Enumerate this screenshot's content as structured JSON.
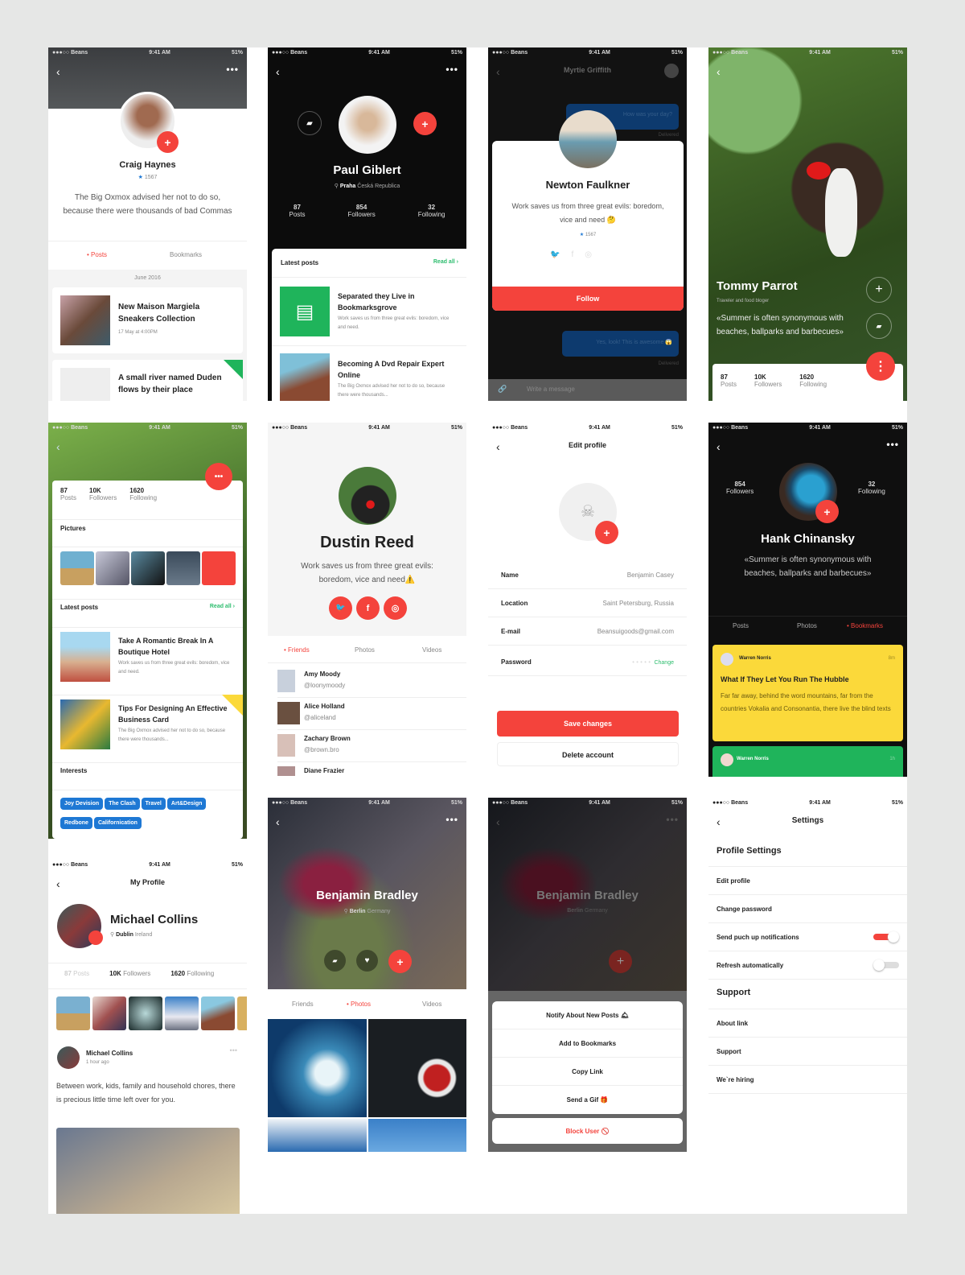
{
  "status": {
    "carrier": "●●●○○ Beans",
    "time": "9:41 AM",
    "battery": "51%"
  },
  "colors": {
    "accent": "#f4433c",
    "link": "#2dbd6e",
    "tag": "#1e78d4",
    "yellow": "#fbd93a",
    "green": "#1fb45b"
  },
  "s1": {
    "name": "Craig Haynes",
    "rating": "1567",
    "bio": "The Big Oxmox advised her not to do so, because there were thousands of bad Commas",
    "tabs": [
      "Posts",
      "Bookmarks"
    ],
    "date": "June 2016",
    "posts": [
      {
        "title": "New Maison Margiela Sneakers Collection",
        "meta": "17 May at 4:00PM"
      },
      {
        "title": "A small river named Duden flows by their place"
      }
    ]
  },
  "s2": {
    "name": "Paul Giblert",
    "city": "Praha",
    "country": "Česká Republica",
    "stats": [
      {
        "v": "87",
        "l": "Posts"
      },
      {
        "v": "854",
        "l": "Followers"
      },
      {
        "v": "32",
        "l": "Following"
      }
    ],
    "latest": "Latest posts",
    "read_all": "Read all ›",
    "posts": [
      {
        "title": "Separated they Live in Bookmarksgrove",
        "text": "Work saves us from three great evils: boredom, vice and need."
      },
      {
        "title": "Becoming A Dvd Repair Expert Online",
        "text": "The Big Oxmox advised her not to do so, because there were thousands..."
      }
    ]
  },
  "s3": {
    "title": "Myrtie Griffith",
    "bubble1": "How was your day?",
    "delivered": "Delivered",
    "bubble2": "Yes, look! This is awesome 😱",
    "name": "Newton Faulkner",
    "text": "Work saves us from three great evils: boredom, vice and need 🤔",
    "rating": "1567",
    "follow": "Follow",
    "input_placeholder": "Write a message"
  },
  "s4": {
    "name": "Tommy Parrot",
    "subtitle": "Traveler and food bloger",
    "quote": "«Summer is often synonymous with beaches, ballparks and barbecues»",
    "stats": [
      {
        "v": "87",
        "l": "Posts"
      },
      {
        "v": "10K",
        "l": "Followers"
      },
      {
        "v": "1620",
        "l": "Following"
      }
    ]
  },
  "s5": {
    "stats": [
      {
        "v": "87",
        "l": "Posts"
      },
      {
        "v": "10K",
        "l": "Followers"
      },
      {
        "v": "1620",
        "l": "Following"
      }
    ],
    "pictures": "Pictures",
    "latest": "Latest posts",
    "read_all": "Read all ›",
    "posts": [
      {
        "title": "Take A Romantic Break In A Boutique Hotel",
        "text": "Work saves us from three great evils: boredom, vice and need."
      },
      {
        "title": "Tips For Designing An Effective Business Card",
        "text": "The Big Oxmox advised her not to do so, because there were thousands..."
      }
    ],
    "interests": "Interests",
    "tags": [
      "Joy Devision",
      "The Clash",
      "Travel",
      "Art&Design",
      "Redbone",
      "Californication"
    ]
  },
  "s6": {
    "name": "Dustin Reed",
    "text": "Work saves us from three great evils: boredom, vice and need⚠️",
    "tabs": [
      "Friends",
      "Photos",
      "Videos"
    ],
    "friends": [
      {
        "name": "Amy Moody",
        "handle": "@loonymoody"
      },
      {
        "name": "Alice Holland",
        "handle": "@aliceland"
      },
      {
        "name": "Zachary Brown",
        "handle": "@brown.bro"
      },
      {
        "name": "Diane Frazier"
      }
    ]
  },
  "s7": {
    "title": "Edit profile",
    "fields": [
      {
        "label": "Name",
        "value": "Benjamin Casey"
      },
      {
        "label": "Location",
        "value": "Saint Petersburg, Russia"
      },
      {
        "label": "E-mail",
        "value": "Beansuigoods@gmail.com"
      },
      {
        "label": "Password",
        "value": "• • • • •",
        "action": "Change"
      }
    ],
    "save": "Save changes",
    "delete": "Delete account"
  },
  "s8": {
    "name": "Hank Chinansky",
    "quote": "«Summer is often synonymous with beaches, ballparks and barbecues»",
    "stats": [
      {
        "v": "854",
        "l": "Followers"
      },
      {
        "v": "32",
        "l": "Following"
      }
    ],
    "tabs": [
      "Posts",
      "Photos",
      "Bookmarks"
    ],
    "cards": [
      {
        "author": "Warren Norris",
        "time": "8m",
        "title": "What If They Let You Run The Hubble",
        "text": "Far far away, behind the word mountains, far from the countries Vokalia and Consonantia, there live the blind texts"
      },
      {
        "author": "Warren Norris",
        "time": "1h"
      }
    ]
  },
  "s9": {
    "title": "My Profile",
    "name": "Michael Collins",
    "city": "Dublin",
    "country": "Ireland",
    "stats": [
      {
        "v": "87",
        "l": "Posts"
      },
      {
        "v": "10K",
        "l": "Followers"
      },
      {
        "v": "1620",
        "l": "Following"
      }
    ],
    "post_author": "Michael Collins",
    "post_time": "1 hour ago",
    "post_text": "Between work, kids, family and household chores, there is precious little time left over for you."
  },
  "s10": {
    "name": "Benjamin Bradley",
    "city": "Berlin",
    "country": "Germany",
    "tabs": [
      "Friends",
      "Photos",
      "Videos"
    ]
  },
  "s11": {
    "name": "Benjamin Bradley",
    "city": "Berlin",
    "country": "Germany",
    "menu": [
      "Notify About New Posts 🛎",
      "Add to Bookmarks",
      "Copy Link",
      "Send a Gif 🎁"
    ],
    "block": "Block User 🚫"
  },
  "s12": {
    "title": "Settings",
    "section1": "Profile Settings",
    "items1": [
      {
        "label": "Edit profile"
      },
      {
        "label": "Change password"
      },
      {
        "label": "Send puch up notifications",
        "toggle": true
      },
      {
        "label": "Refresh automatically",
        "toggle": false
      }
    ],
    "section2": "Support",
    "items2": [
      "About link",
      "Support",
      "We`re hiring"
    ]
  }
}
